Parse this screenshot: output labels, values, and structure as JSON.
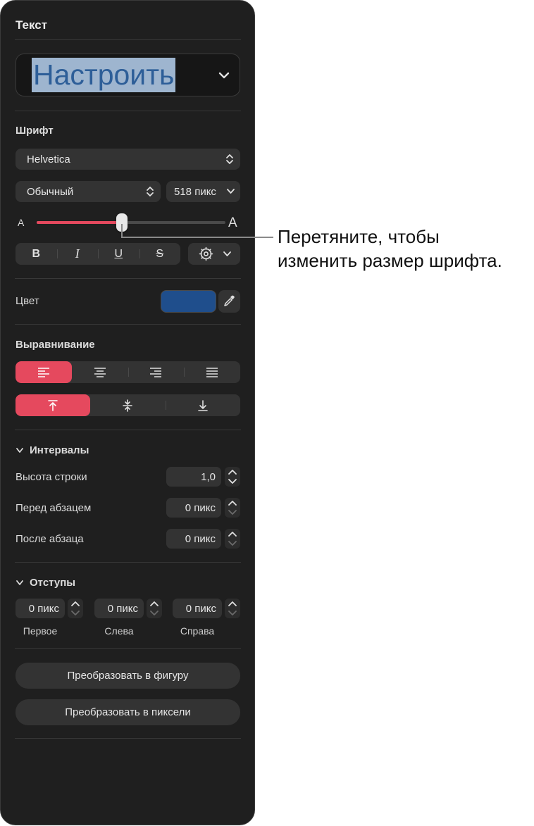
{
  "panel": {
    "title": "Текст"
  },
  "preset": {
    "label": "Настроить"
  },
  "font": {
    "section": "Шрифт",
    "family": "Helvetica",
    "style": "Обычный",
    "size": "518 пикс",
    "slider_small_label": "A",
    "slider_large_label": "A",
    "slider_fraction": 0.45,
    "bold": "B",
    "italic": "I",
    "underline": "U",
    "strike": "S"
  },
  "color": {
    "label": "Цвет",
    "swatch": "#1f4e8c"
  },
  "alignment": {
    "section": "Выравнивание"
  },
  "spacing": {
    "section": "Интервалы",
    "line_height_label": "Высота строки",
    "line_height_value": "1,0",
    "before_label": "Перед абзацем",
    "before_value": "0 пикс",
    "after_label": "После абзаца",
    "after_value": "0 пикс"
  },
  "indents": {
    "section": "Отступы",
    "first_value": "0 пикс",
    "left_value": "0 пикс",
    "right_value": "0 пикс",
    "first_label": "Первое",
    "left_label": "Слева",
    "right_label": "Справа"
  },
  "actions": {
    "to_shape": "Преобразовать в фигуру",
    "to_pixels": "Преобразовать в пиксели"
  },
  "callout": {
    "line1": "Перетяните, чтобы",
    "line2": "изменить размер шрифта."
  },
  "colors": {
    "accent": "#e5495e",
    "panel": "#1f1f1f",
    "control": "#333333"
  }
}
